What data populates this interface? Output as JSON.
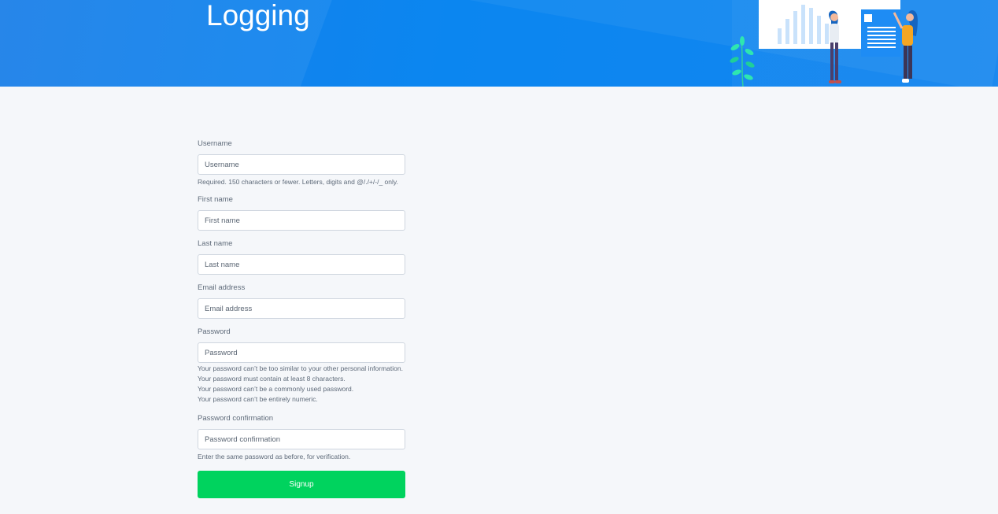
{
  "header": {
    "title": "Logging",
    "illustration": "analytics-board-people-illustration",
    "brand_color": "#0b86f0"
  },
  "form": {
    "username": {
      "label": "Username",
      "placeholder": "Username",
      "help": "Required. 150 characters or fewer. Letters, digits and @/./+/-/_ only."
    },
    "first_name": {
      "label": "First name",
      "placeholder": "First name"
    },
    "last_name": {
      "label": "Last name",
      "placeholder": "Last name"
    },
    "email": {
      "label": "Email address",
      "placeholder": "Email address"
    },
    "password": {
      "label": "Password",
      "placeholder": "Password",
      "help": [
        "Your password can’t be too similar to your other personal information.",
        "Your password must contain at least 8 characters.",
        "Your password can’t be a commonly used password.",
        "Your password can’t be entirely numeric."
      ]
    },
    "password_confirmation": {
      "label": "Password confirmation",
      "placeholder": "Password confirmation",
      "help": "Enter the same password as before, for verification."
    },
    "submit_label": "Signup",
    "submit_color": "#00d35e"
  }
}
